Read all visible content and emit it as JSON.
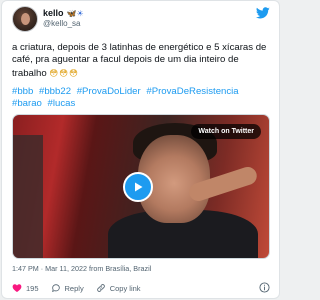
{
  "author": {
    "display_name": "kello",
    "name_emoji": "🦋☀",
    "handle": "@kello_sa"
  },
  "tweet": {
    "text": "a criatura, depois de 3 latinhas de energético e 5 xícaras de café, pra aguentar a facul depois de um dia inteiro de trabalho",
    "text_emojis": "😳😳😳",
    "hashtags": [
      "#bbb",
      "#bbb22",
      "#ProvaDoLider",
      "#ProvaDeResistencia",
      "#barao",
      "#lucas"
    ]
  },
  "media": {
    "watch_label": "Watch on Twitter"
  },
  "meta": {
    "timestamp": "1:47 PM · Mar 11, 2022 from Brasília, Brazil"
  },
  "actions": {
    "like_count": "195",
    "reply_label": "Reply",
    "copy_label": "Copy link"
  },
  "colors": {
    "accent": "#1d9bf0",
    "like": "#f91880",
    "text": "#0f1419",
    "muted": "#536471"
  }
}
